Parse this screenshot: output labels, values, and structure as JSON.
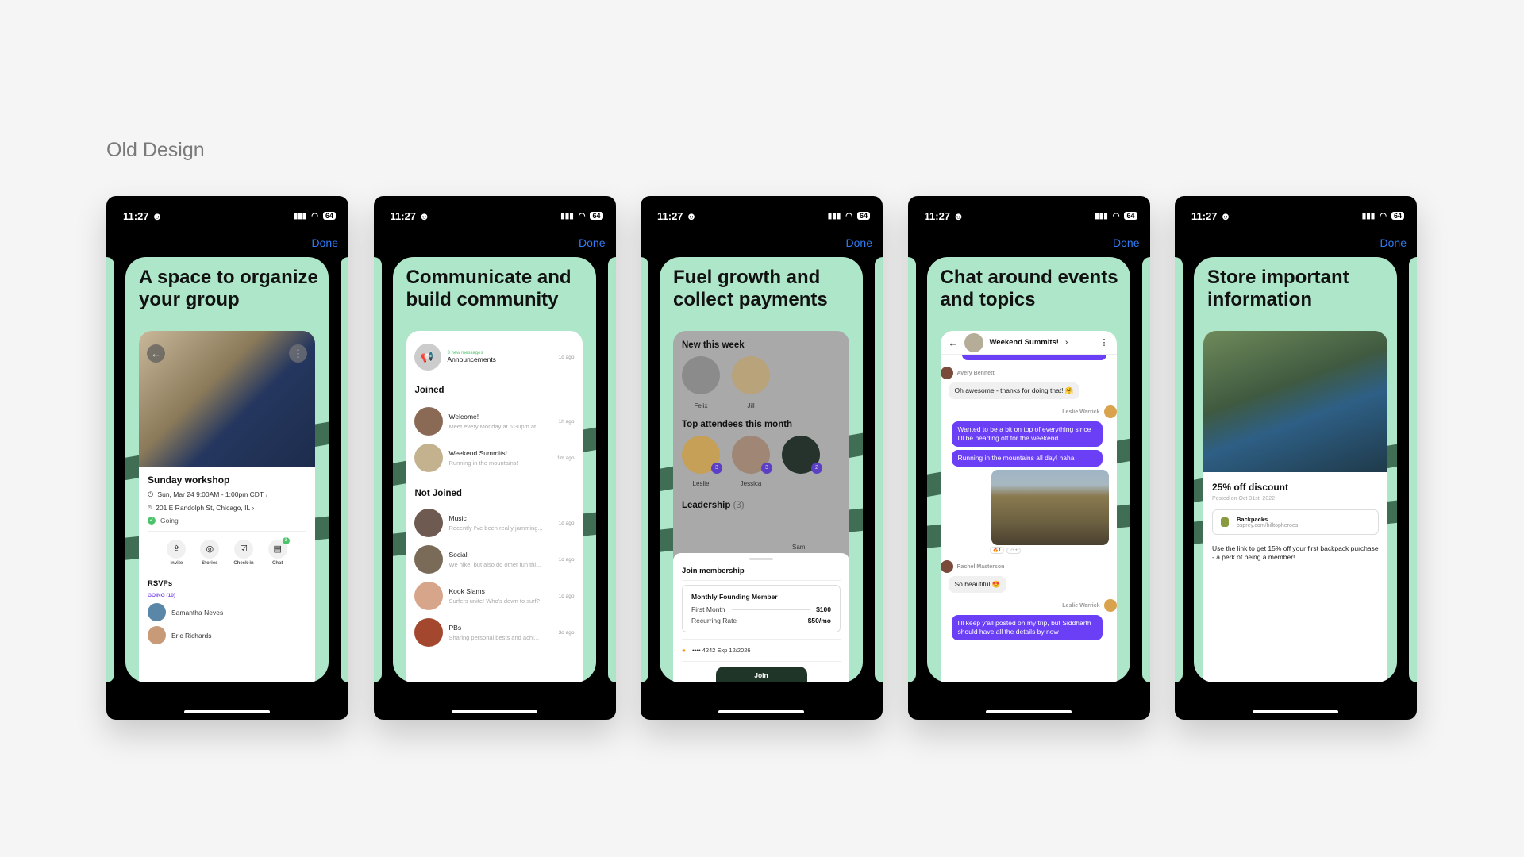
{
  "section_title": "Old Design",
  "status": {
    "time": "11:27",
    "battery": "64"
  },
  "done_label": "Done",
  "colors": {
    "card": "#ade6c8",
    "stripe": "#3f6e55",
    "accent_purple": "#6b3ff5",
    "link_blue": "#2f7bf5"
  },
  "phones": [
    {
      "title": "A space to organize your group",
      "event": {
        "name": "Sunday workshop",
        "time": "Sun, Mar 24 9:00AM - 1:00pm CDT",
        "location": "201 E Randolph St, Chicago, IL",
        "status": "Going"
      },
      "actions": [
        {
          "label": "Invite",
          "icon": "share-icon"
        },
        {
          "label": "Stories",
          "icon": "instagram-icon"
        },
        {
          "label": "Check-in",
          "icon": "clipboard-icon"
        },
        {
          "label": "Chat",
          "icon": "chat-icon",
          "badge": "3"
        }
      ],
      "rsvps_title": "RSVPs",
      "going_label": "GOING (10)",
      "attendees": [
        "Samantha Neves",
        "Eric Richards"
      ]
    },
    {
      "title": "Communicate and build community",
      "announcement": {
        "count_label": "3 new messages",
        "name": "Announcements",
        "time": "1d ago"
      },
      "joined_title": "Joined",
      "joined": [
        {
          "name": "Welcome!",
          "preview": "Meet every Monday at 6:30pm at...",
          "time": "1h ago"
        },
        {
          "name": "Weekend Summits!",
          "preview": "Running in the mountains!",
          "time": "1m ago"
        }
      ],
      "not_joined_title": "Not Joined",
      "not_joined": [
        {
          "name": "Music",
          "preview": "Recently I've been really jamming...",
          "time": "1d ago"
        },
        {
          "name": "Social",
          "preview": "We hike, but also do other fun thi...",
          "time": "1d ago"
        },
        {
          "name": "Kook Slams",
          "preview": "Surfers unite! Who's down to surf?",
          "time": "1d ago"
        },
        {
          "name": "PBs",
          "preview": "Sharing personal bests and achi...",
          "time": "3d ago"
        }
      ]
    },
    {
      "title": "Fuel growth and collect payments",
      "new_title": "New this week",
      "new_members": [
        "Felix",
        "Jill"
      ],
      "top_title": "Top attendees this month",
      "top": [
        {
          "name": "Leslie",
          "count": "3"
        },
        {
          "name": "Jessica",
          "count": "3"
        },
        {
          "name": "",
          "count": "2"
        }
      ],
      "leadership_title": "Leadership",
      "leadership_count": "(3)",
      "leader_name": "Sam",
      "sheet": {
        "title": "Join membership",
        "plan": "Monthly Founding Member",
        "first_label": "First Month",
        "first_value": "$100",
        "recurring_label": "Recurring Rate",
        "recurring_value": "$50/mo",
        "card": "•••• 4242 Exp 12/2026",
        "join": "Join"
      }
    },
    {
      "title": "Chat around events and topics",
      "chat_title": "Weekend Summits!",
      "messages": [
        {
          "author": "Avery Bennett",
          "text": "Oh awesome - thanks for doing that! 🤗",
          "mine": false
        },
        {
          "author": "Leslie Warrick",
          "text": "Wanted to be a bit on top of everything since I'll be heading off for the weekend",
          "mine": true
        },
        {
          "author": "",
          "text": "Running in the mountains all day! haha",
          "mine": true
        },
        {
          "author": "Rachel Masterson",
          "text": "So beautiful 😍",
          "mine": false
        },
        {
          "author": "Leslie Warrick",
          "text": "I'll keep y'all posted on my trip, but Siddharth should have all the details by now",
          "mine": true
        }
      ],
      "reaction": "🔥1"
    },
    {
      "title": "Store important information",
      "post_title": "25% off discount",
      "posted": "Posted on Oct 31st, 2022",
      "link_title": "Backpacks",
      "link_url": "osprey.com/hilltopheroes",
      "body": "Use the link to get 15% off your first backpack purchase - a perk of being a member!"
    }
  ]
}
